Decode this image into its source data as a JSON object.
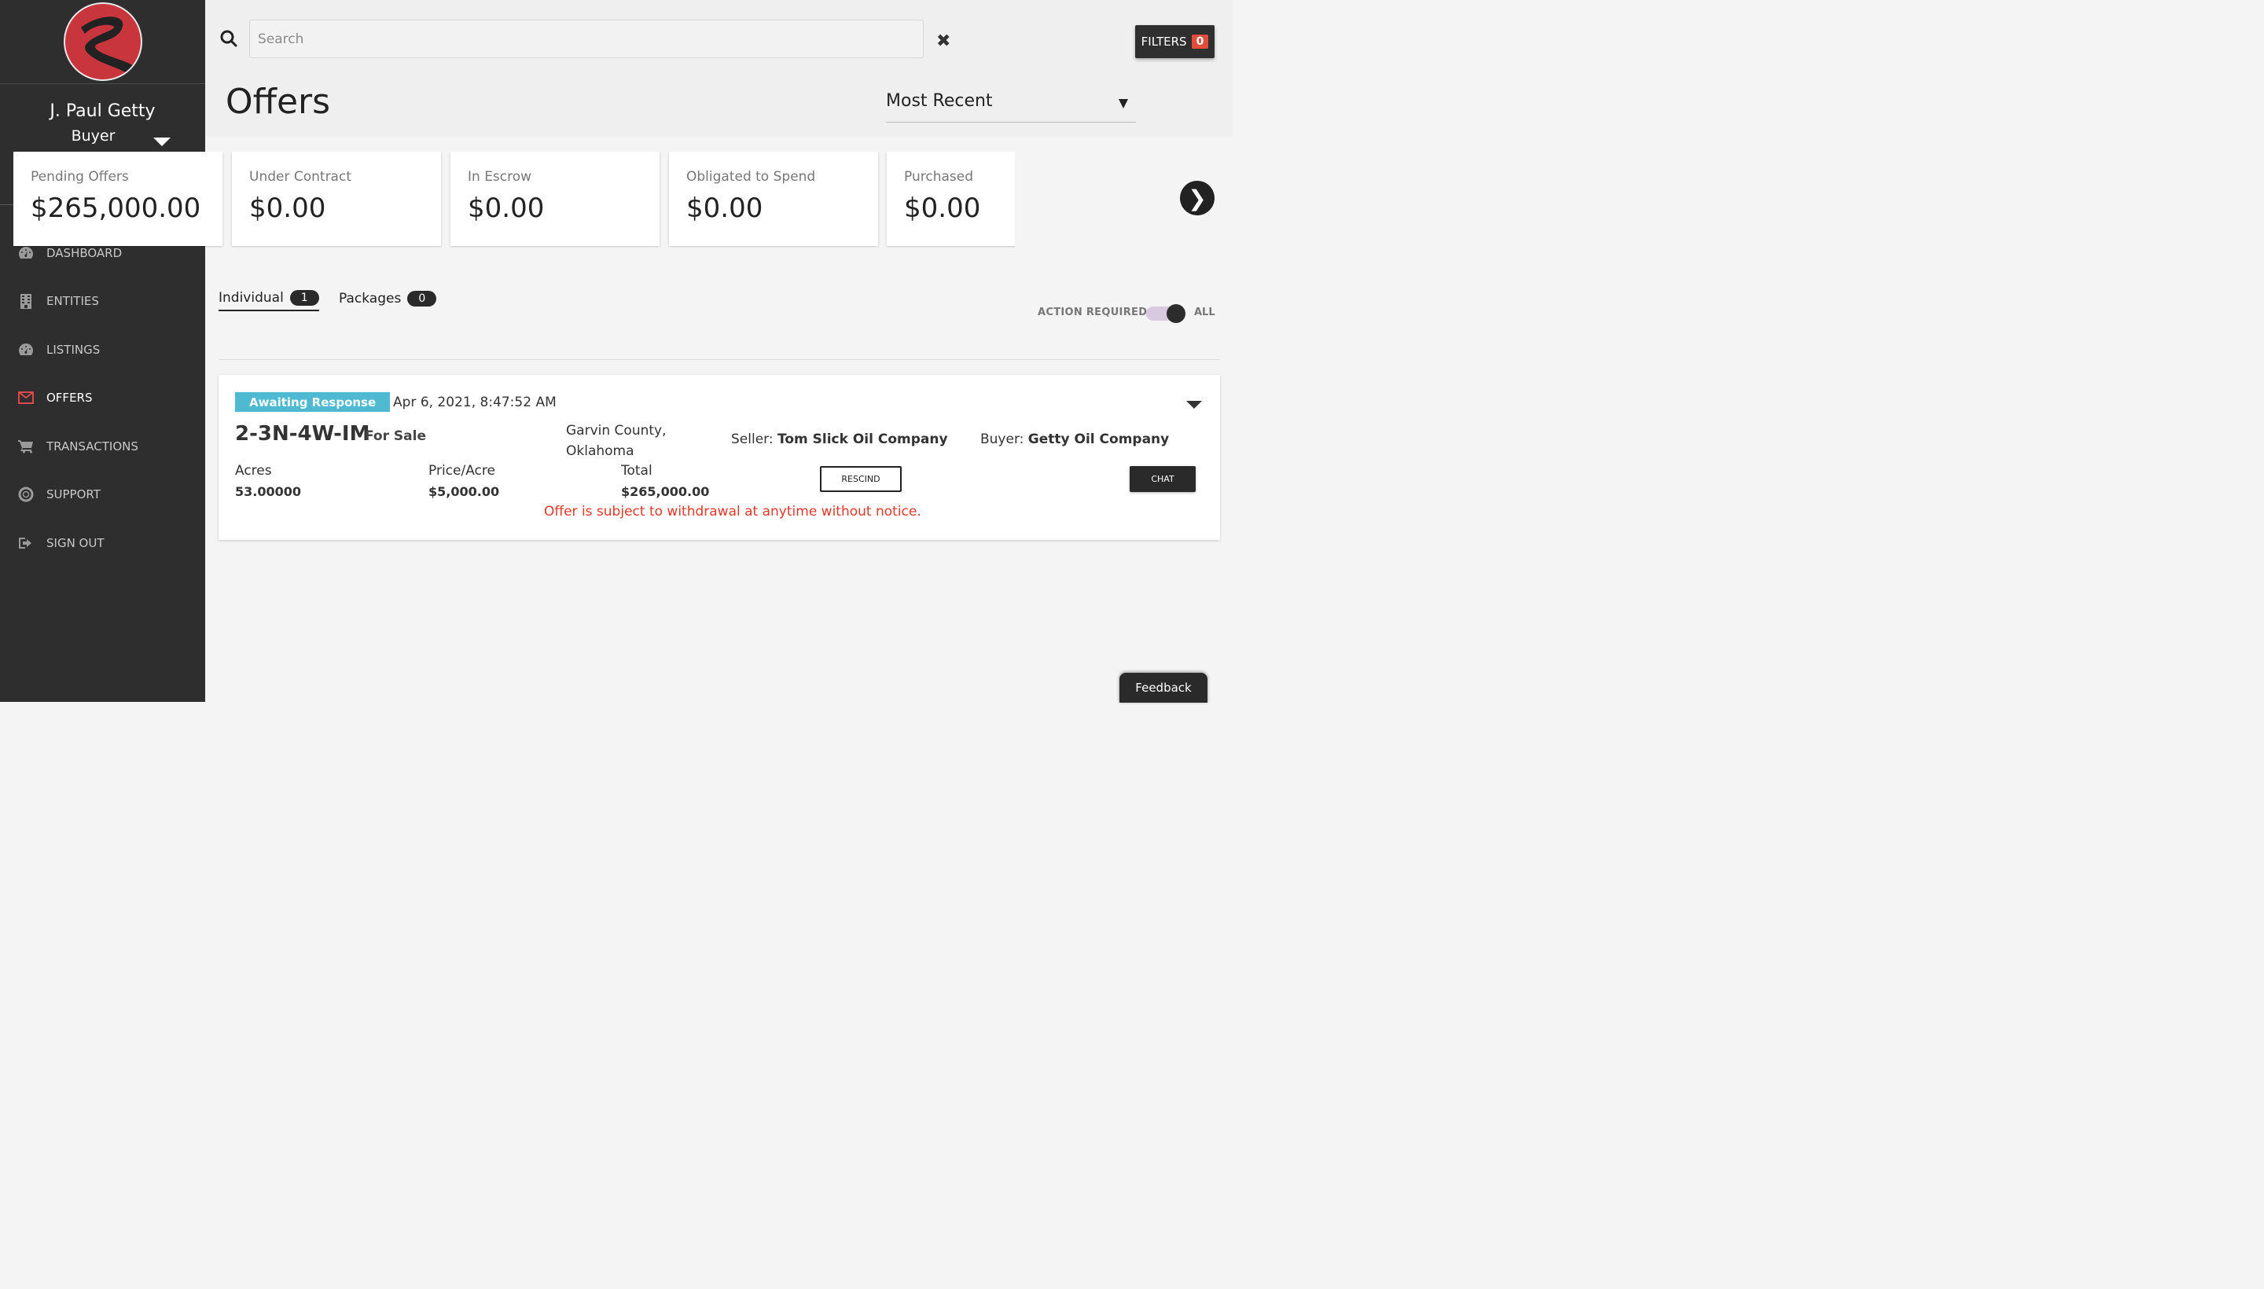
{
  "user": {
    "name": "J. Paul Getty",
    "role": "Buyer"
  },
  "nav": [
    {
      "label": "DASHBOARD",
      "icon": "dashboard-icon",
      "active": false
    },
    {
      "label": "ENTITIES",
      "icon": "building-icon",
      "active": false
    },
    {
      "label": "LISTINGS",
      "icon": "dashboard-icon",
      "active": false
    },
    {
      "label": "OFFERS",
      "icon": "envelope-icon",
      "active": true
    },
    {
      "label": "TRANSACTIONS",
      "icon": "cart-icon",
      "active": false
    },
    {
      "label": "SUPPORT",
      "icon": "lifebuoy-icon",
      "active": false
    },
    {
      "label": "SIGN OUT",
      "icon": "sign-out-icon",
      "active": false
    }
  ],
  "search": {
    "placeholder": "Search",
    "value": ""
  },
  "filters": {
    "label": "FILTERS",
    "count": "0"
  },
  "page": {
    "title": "Offers",
    "sort": "Most Recent"
  },
  "summary": [
    {
      "label": "Pending Offers",
      "value": "$265,000.00"
    },
    {
      "label": "Under Contract",
      "value": "$0.00"
    },
    {
      "label": "In Escrow",
      "value": "$0.00"
    },
    {
      "label": "Obligated to Spend",
      "value": "$0.00"
    },
    {
      "label": "Purchased",
      "value": "$0.00"
    }
  ],
  "tabs": [
    {
      "label": "Individual",
      "count": "1",
      "active": true
    },
    {
      "label": "Packages",
      "count": "0",
      "active": false
    }
  ],
  "toggle": {
    "left_label": "ACTION REQUIRED",
    "right_label": "ALL"
  },
  "offer": {
    "status_badge": "Awaiting Response",
    "date": "Apr 6, 2021, 8:47:52 AM",
    "id": "2-3N-4W-IM",
    "listing_status": "For Sale",
    "location": "Garvin County, Oklahoma",
    "seller_label": "Seller:",
    "seller": "Tom Slick Oil Company",
    "buyer_label": "Buyer:",
    "buyer": "Getty Oil Company",
    "acres_label": "Acres",
    "acres": "53.00000",
    "price_label": "Price/Acre",
    "price": "$5,000.00",
    "total_label": "Total",
    "total": "$265,000.00",
    "rescind_label": "RESCIND",
    "chat_label": "CHAT",
    "notice": "Offer is subject to withdrawal at anytime without notice."
  },
  "feedback_label": "Feedback",
  "colors": {
    "accent": "#e0474c",
    "badge": "#4fb9d1",
    "notice": "#e0392b",
    "sidebar": "#2e2e2e"
  }
}
